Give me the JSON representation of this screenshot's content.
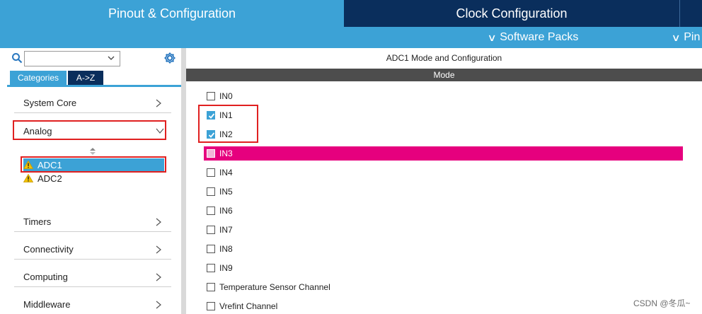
{
  "tabs": {
    "pinout": "Pinout & Configuration",
    "clock": "Clock Configuration"
  },
  "subbar": {
    "software_packs": "Software Packs",
    "pinout_truncated": "Pin"
  },
  "left": {
    "search": {
      "value": "",
      "placeholder": ""
    },
    "category_tabs": {
      "categories": "Categories",
      "az": "A->Z"
    },
    "categories": [
      {
        "label": "System Core",
        "expanded": false
      },
      {
        "label": "Analog",
        "expanded": true
      },
      {
        "label": "Timers",
        "expanded": false
      },
      {
        "label": "Connectivity",
        "expanded": false
      },
      {
        "label": "Computing",
        "expanded": false
      },
      {
        "label": "Middleware",
        "expanded": false
      }
    ],
    "analog_items": [
      {
        "label": "ADC1",
        "selected": true,
        "status_icon": "warning-icon"
      },
      {
        "label": "ADC2",
        "selected": false,
        "status_icon": "warning-icon"
      }
    ]
  },
  "right": {
    "title": "ADC1 Mode and Configuration",
    "mode_header": "Mode",
    "channels": [
      {
        "label": "IN0",
        "checked": false,
        "highlighted": false
      },
      {
        "label": "IN1",
        "checked": true,
        "highlighted": false
      },
      {
        "label": "IN2",
        "checked": true,
        "highlighted": false
      },
      {
        "label": "IN3",
        "checked": false,
        "highlighted": true
      },
      {
        "label": "IN4",
        "checked": false,
        "highlighted": false
      },
      {
        "label": "IN5",
        "checked": false,
        "highlighted": false
      },
      {
        "label": "IN6",
        "checked": false,
        "highlighted": false
      },
      {
        "label": "IN7",
        "checked": false,
        "highlighted": false
      },
      {
        "label": "IN8",
        "checked": false,
        "highlighted": false
      },
      {
        "label": "IN9",
        "checked": false,
        "highlighted": false
      },
      {
        "label": "Temperature Sensor Channel",
        "checked": false,
        "highlighted": false
      },
      {
        "label": "Vrefint Channel",
        "checked": false,
        "highlighted": false
      }
    ]
  },
  "watermark": "CSDN @冬瓜~",
  "colors": {
    "accent_blue": "#3ca2d6",
    "dark_navy": "#0a2e5c",
    "highlight_magenta": "#e6007e",
    "annotation_red": "#e02020"
  }
}
